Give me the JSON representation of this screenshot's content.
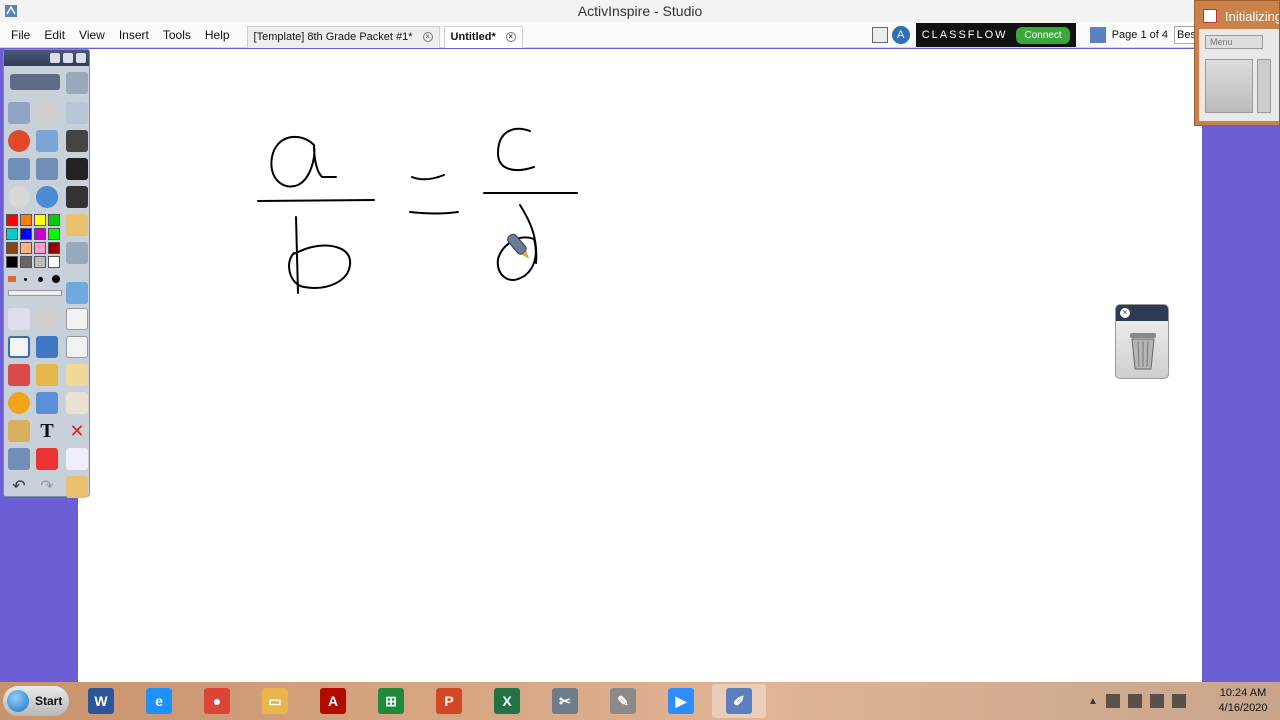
{
  "window": {
    "title": "ActivInspire - Studio"
  },
  "menu": [
    "File",
    "Edit",
    "View",
    "Insert",
    "Tools",
    "Help"
  ],
  "tabs": [
    {
      "label": "[Template] 8th Grade Packet #1*",
      "active": false
    },
    {
      "label": "Untitled*",
      "active": true
    }
  ],
  "classflow": {
    "logo": "CLASSFLOW",
    "connect": "Connect"
  },
  "page_indicator": "Page 1 of 4",
  "zoom_select": "Best",
  "side_panel": {
    "title": "Initializing",
    "menu_label": "Menu"
  },
  "toolbox": {
    "palette": [
      "#ff0000",
      "#ff8000",
      "#ffff00",
      "#00cc00",
      "#00cccc",
      "#0000ff",
      "#cc00cc",
      "#00ff00",
      "#8b4513",
      "#ffb080",
      "#ff99cc",
      "#990000",
      "#000000",
      "#666666",
      "#bbbbbb",
      "#ffffff"
    ]
  },
  "taskbar": {
    "start_label": "Start",
    "apps": [
      {
        "name": "Word",
        "glyph": "W",
        "color": "#2b579a"
      },
      {
        "name": "Internet Explorer",
        "glyph": "e",
        "color": "#1e90ff"
      },
      {
        "name": "Chrome",
        "glyph": "●",
        "color": "#db4437"
      },
      {
        "name": "File Explorer",
        "glyph": "▭",
        "color": "#e8b64c"
      },
      {
        "name": "Acrobat",
        "glyph": "A",
        "color": "#b30b00"
      },
      {
        "name": "Store",
        "glyph": "⊞",
        "color": "#1e8a3a"
      },
      {
        "name": "PowerPoint",
        "glyph": "P",
        "color": "#d24726"
      },
      {
        "name": "Excel",
        "glyph": "X",
        "color": "#217346"
      },
      {
        "name": "Snipping",
        "glyph": "✂",
        "color": "#6d7d8c"
      },
      {
        "name": "Paint",
        "glyph": "✎",
        "color": "#8a8a8a"
      },
      {
        "name": "Zoom",
        "glyph": "▶",
        "color": "#2d8cff"
      },
      {
        "name": "ActivInspire",
        "glyph": "✐",
        "color": "#5b7fbf"
      }
    ],
    "clock_time": "10:24 AM",
    "clock_date": "4/16/2020"
  }
}
